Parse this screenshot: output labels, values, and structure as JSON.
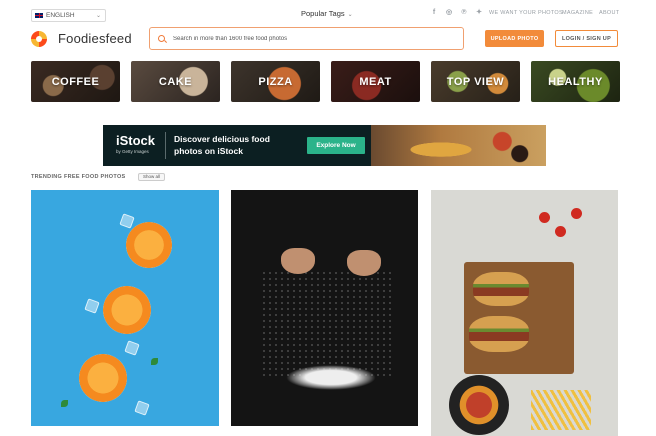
{
  "topbar": {
    "language": "ENGLISH",
    "popular_tags": "Popular Tags",
    "social_icons": [
      "facebook-icon",
      "instagram-icon",
      "pinterest-icon",
      "twitter-icon"
    ],
    "links": [
      "WE WANT YOUR PHOTOS",
      "MAGAZINE",
      "ABOUT"
    ]
  },
  "header": {
    "brand": "Foodiesfeed",
    "search_placeholder": "Search in more than 1600 free food photos",
    "upload_label": "UPLOAD PHOTO",
    "login_label": "LOGIN / SIGN UP"
  },
  "categories": [
    "COFFEE",
    "CAKE",
    "PIZZA",
    "MEAT",
    "TOP VIEW",
    "HEALTHY"
  ],
  "ad": {
    "logo": "iStock",
    "sublogo": "by Getty Images",
    "headline": "Discover delicious food photos on iStock",
    "cta": "Explore Now"
  },
  "trending": {
    "title": "TRENDING FREE FOOD PHOTOS",
    "show_all": "Show all"
  },
  "colors": {
    "accent": "#f28b3a",
    "ad_background": "#0c1f22",
    "ad_button": "#2bb38a"
  }
}
